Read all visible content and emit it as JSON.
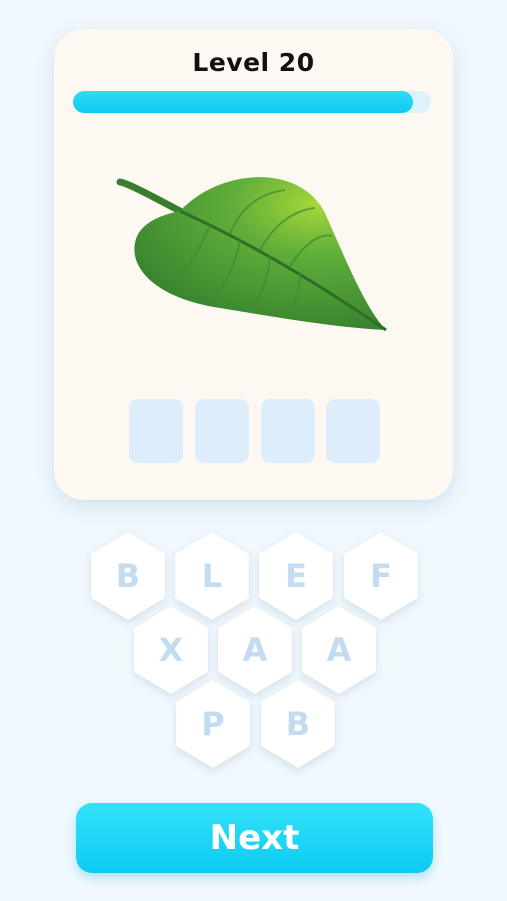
{
  "level": {
    "title": "Level 20"
  },
  "progress": {
    "fraction": 0.95
  },
  "image": {
    "subject": "leaf"
  },
  "answer_slots": [
    "",
    "",
    "",
    ""
  ],
  "letter_tiles": [
    {
      "row": 1,
      "letters": [
        "B",
        "L",
        "E",
        "F"
      ]
    },
    {
      "row": 2,
      "letters": [
        "X",
        "A",
        "A"
      ]
    },
    {
      "row": 3,
      "letters": [
        "P",
        "B"
      ]
    }
  ],
  "next_button": {
    "label": "Next"
  },
  "colors": {
    "background": "#f0f8fd",
    "card": "#fdf8f2",
    "accent": "#14cdf1",
    "tile_letter": "#c3dcf2",
    "slot": "#deedfb"
  }
}
